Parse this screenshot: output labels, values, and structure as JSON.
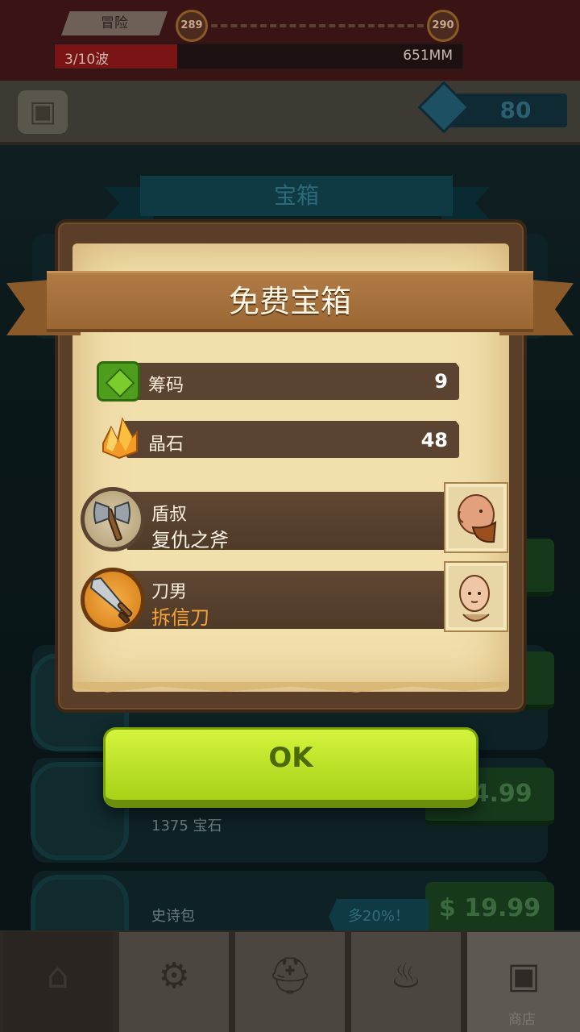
{
  "hud": {
    "mode": "冒险",
    "level_current": "289",
    "level_next": "290",
    "wave": "3/10波",
    "distance": "651MM",
    "gems": "80",
    "wave_progress": 0.3
  },
  "shop": {
    "section_title": "宝箱",
    "items": [
      {
        "label": "1375 宝石",
        "price": "$ 4.99"
      },
      {
        "label": "史诗包",
        "price": "$ 19.99",
        "bonus": "多20%！"
      }
    ]
  },
  "nav": {
    "shop_label": "商店"
  },
  "modal": {
    "title": "免费宝箱",
    "rewards": [
      {
        "icon": "chip-icon",
        "label": "筹码",
        "value": "9"
      },
      {
        "icon": "crystal-icon",
        "label": "晶石",
        "value": "48"
      }
    ],
    "items": [
      {
        "icon": "axe-icon",
        "hero": "盾叔",
        "weapon": "复仇之斧",
        "rarity": "common"
      },
      {
        "icon": "sword-icon",
        "hero": "刀男",
        "weapon": "拆信刀",
        "rarity": "rare"
      }
    ],
    "ok_label": "OK"
  },
  "colors": {
    "ok_button": "#c3e62d",
    "rare_weapon": "#f7a33a",
    "ribbon": "#a06b38",
    "paper": "#f1dfac"
  }
}
